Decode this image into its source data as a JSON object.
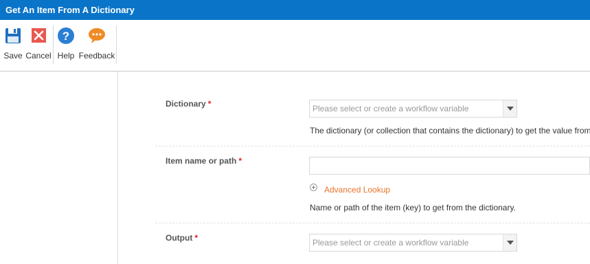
{
  "window": {
    "title": "Get An Item From A Dictionary"
  },
  "toolbar": {
    "save_label": "Save",
    "cancel_label": "Cancel",
    "help_label": "Help",
    "feedback_label": "Feedback"
  },
  "form": {
    "dictionary": {
      "label": "Dictionary",
      "required_mark": "*",
      "placeholder": "Please select or create a workflow variable",
      "help": "The dictionary (or collection that contains the dictionary) to get the value from."
    },
    "item": {
      "label": "Item name or path",
      "required_mark": "*",
      "value": "",
      "advanced_lookup": "Advanced Lookup",
      "help": "Name or path of the item (key) to get from the dictionary."
    },
    "output": {
      "label": "Output",
      "required_mark": "*",
      "placeholder": "Please select or create a workflow variable"
    }
  },
  "colors": {
    "titlebar": "#0a74c9",
    "save_icon": "#1e70bf",
    "cancel_icon": "#e8584f",
    "help_icon": "#2a7fd4",
    "feedback_icon": "#f08a24",
    "link": "#e8732a",
    "required": "#e02020"
  },
  "icons": {
    "save": "floppy-disk-icon",
    "cancel": "close-icon",
    "help": "question-mark-icon",
    "feedback": "speech-bubble-icon",
    "advanced_lookup": "plus-circle-icon"
  }
}
